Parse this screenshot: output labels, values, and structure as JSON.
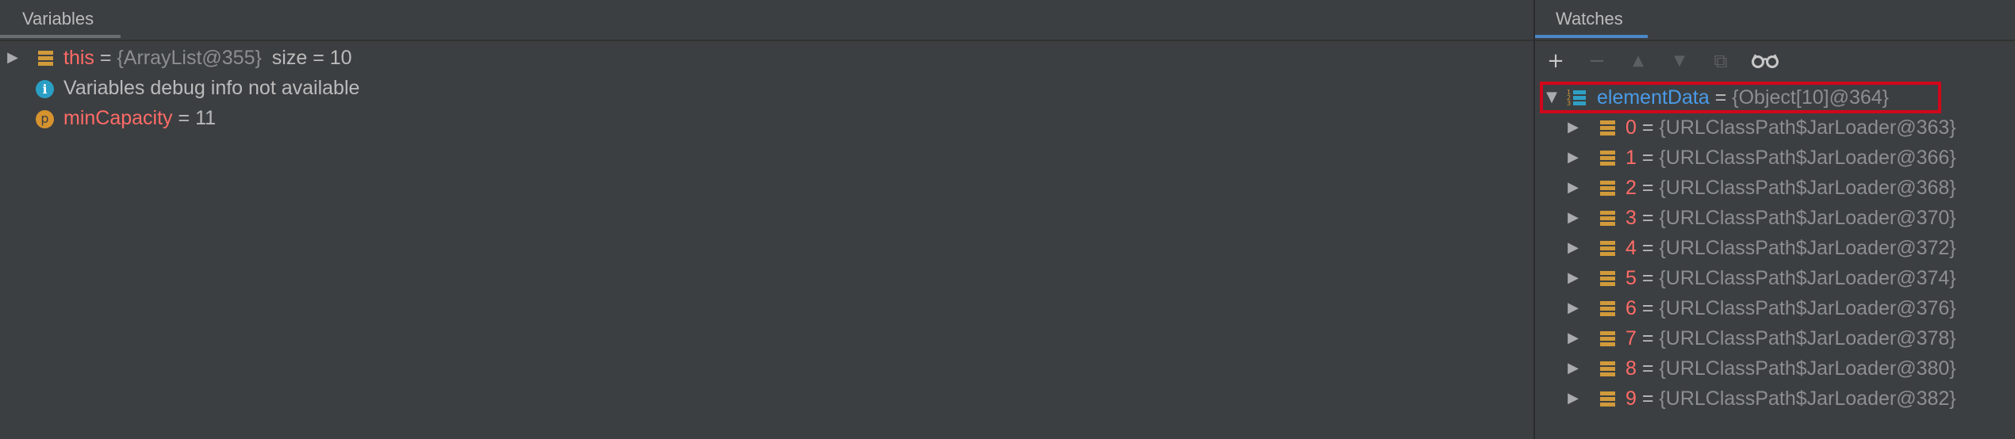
{
  "variables_panel": {
    "tab_label": "Variables",
    "rows": [
      {
        "name": "this",
        "eq": "=",
        "value": "{ArrayList@355}",
        "extra": "size = 10"
      },
      {
        "text": "Variables debug info not available"
      },
      {
        "name": "minCapacity",
        "eq": "=",
        "value": "11",
        "icon_letter": "p"
      }
    ]
  },
  "watches_panel": {
    "tab_label": "Watches",
    "toolbar": {
      "add": "+",
      "remove": "−",
      "up": "▲",
      "down": "▼",
      "copy": "⧉",
      "glasses": "👓"
    },
    "root": {
      "name": "elementData",
      "eq": "=",
      "value": "{Object[10]@364}"
    },
    "children": [
      {
        "name": "0",
        "eq": "=",
        "value": "{URLClassPath$JarLoader@363}"
      },
      {
        "name": "1",
        "eq": "=",
        "value": "{URLClassPath$JarLoader@366}"
      },
      {
        "name": "2",
        "eq": "=",
        "value": "{URLClassPath$JarLoader@368}"
      },
      {
        "name": "3",
        "eq": "=",
        "value": "{URLClassPath$JarLoader@370}"
      },
      {
        "name": "4",
        "eq": "=",
        "value": "{URLClassPath$JarLoader@372}"
      },
      {
        "name": "5",
        "eq": "=",
        "value": "{URLClassPath$JarLoader@374}"
      },
      {
        "name": "6",
        "eq": "=",
        "value": "{URLClassPath$JarLoader@376}"
      },
      {
        "name": "7",
        "eq": "=",
        "value": "{URLClassPath$JarLoader@378}"
      },
      {
        "name": "8",
        "eq": "=",
        "value": "{URLClassPath$JarLoader@380}"
      },
      {
        "name": "9",
        "eq": "=",
        "value": "{URLClassPath$JarLoader@382}"
      }
    ]
  },
  "icons": {
    "collapsed_arrow": "▶",
    "expanded_arrow": "▼",
    "info_letter": "i",
    "array_index_digits": [
      "1",
      "2",
      "3"
    ]
  },
  "colors": {
    "background": "#3c3f41",
    "variable_name": "#ff6b68",
    "watch_name": "#4a9be8",
    "object_icon": "#d19a3a",
    "highlight": "#d1071b",
    "active_tab_underline": "#4a88c7"
  }
}
